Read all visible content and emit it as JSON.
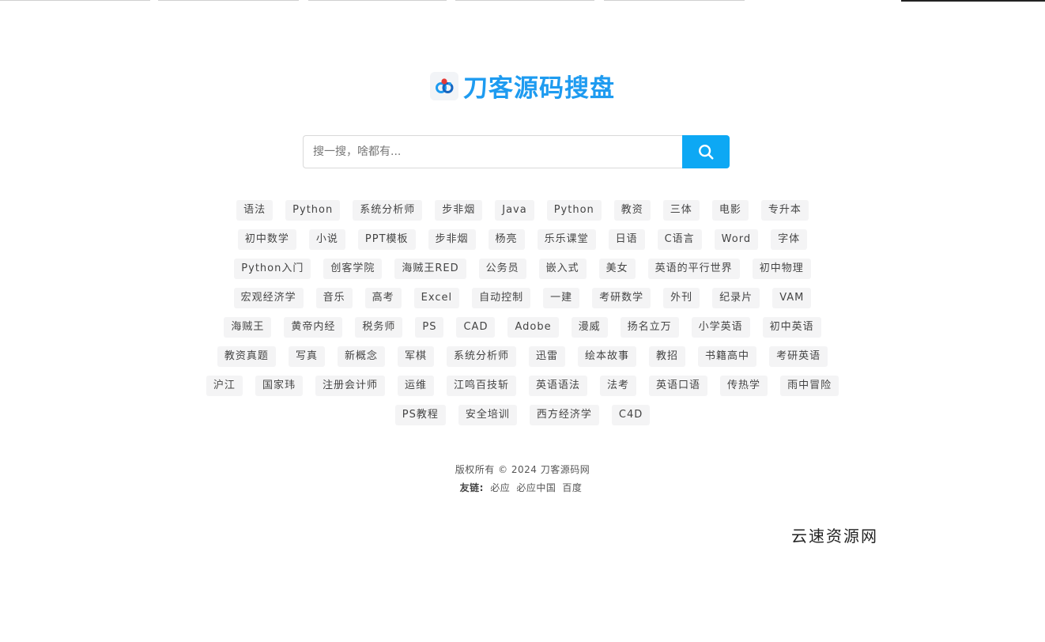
{
  "brand": {
    "logo_icon": "cloud-link-icon",
    "title": "刀客源码搜盘",
    "accent_color": "#1e9bf0"
  },
  "search": {
    "placeholder": "搜一搜，啥都有...",
    "value": "",
    "button_icon": "search-icon",
    "button_color": "#0da8f4"
  },
  "tags": [
    [
      "语法",
      "Python",
      "系统分析师",
      "步非烟",
      "Java",
      "Python",
      "教资",
      "三体",
      "电影",
      "专升本"
    ],
    [
      "初中数学",
      "小说",
      "PPT模板",
      "步非烟",
      "杨亮",
      "乐乐课堂",
      "日语",
      "C语言",
      "Word",
      "字体"
    ],
    [
      "Python入门",
      "创客学院",
      "海贼王RED",
      "公务员",
      "嵌入式",
      "美女",
      "英语的平行世界",
      "初中物理"
    ],
    [
      "宏观经济学",
      "音乐",
      "高考",
      "Excel",
      "自动控制",
      "一建",
      "考研数学",
      "外刊",
      "纪录片",
      "VAM"
    ],
    [
      "海贼王",
      "黄帝内经",
      "税务师",
      "PS",
      "CAD",
      "Adobe",
      "漫威",
      "扬名立万",
      "小学英语",
      "初中英语"
    ],
    [
      "教资真题",
      "写真",
      "新概念",
      "军棋",
      "系统分析师",
      "迅雷",
      "绘本故事",
      "教招",
      "书籍高中",
      "考研英语"
    ],
    [
      "沪江",
      "国家玮",
      "注册会计师",
      "运维",
      "江鸣百技斩",
      "英语语法",
      "法考",
      "英语口语",
      "传热学",
      "雨中冒险"
    ],
    [
      "PS教程",
      "安全培训",
      "西方经济学",
      "C4D"
    ]
  ],
  "footer": {
    "copyright": "版权所有 © 2024 刀客源码网",
    "friends_label": "友链:",
    "friend_links": [
      "必应",
      "必应中国",
      "百度"
    ]
  },
  "watermark": "云速资源网"
}
